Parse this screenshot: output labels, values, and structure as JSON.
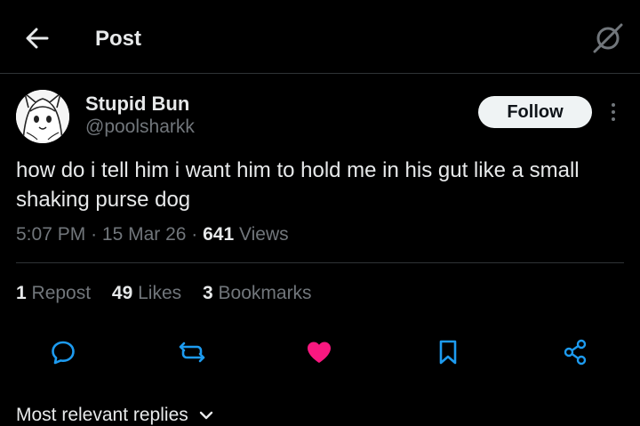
{
  "header": {
    "back_icon": "arrow-left-icon",
    "title": "Post",
    "grok_icon": "grok-icon"
  },
  "author": {
    "display_name": "Stupid Bun",
    "handle": "@poolsharkk",
    "avatar_icon": "avatar-illustration",
    "follow_label": "Follow",
    "more_icon": "more-vertical-icon"
  },
  "post": {
    "text": "how do i tell him i want him to hold me in his gut like a small shaking purse dog",
    "time": "5:07 PM",
    "date": "15 Mar 26",
    "views_count": "641",
    "views_label": "Views"
  },
  "stats": {
    "reposts_count": "1",
    "reposts_label": "Repost",
    "likes_count": "49",
    "likes_label": "Likes",
    "bookmarks_count": "3",
    "bookmarks_label": "Bookmarks"
  },
  "actions": {
    "reply_icon": "reply-icon",
    "repost_icon": "repost-icon",
    "like_icon": "heart-icon",
    "bookmark_icon": "bookmark-icon",
    "share_icon": "share-icon"
  },
  "replies": {
    "filter_label": "Most relevant replies"
  },
  "colors": {
    "background": "#000000",
    "text": "#e7e9ea",
    "muted": "#71767b",
    "like": "#f91880",
    "follow_bg": "#eff3f4"
  }
}
